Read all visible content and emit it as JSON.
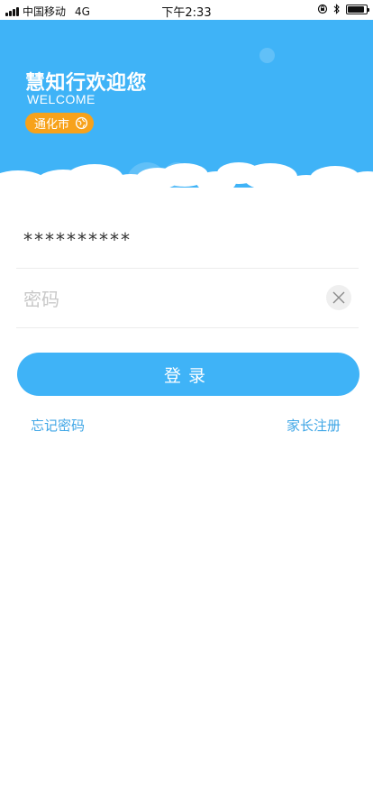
{
  "status_bar": {
    "carrier": "中国移动",
    "network": "4G",
    "time": "下午2:33",
    "battery_level": 0.9
  },
  "header": {
    "title": "慧知行欢迎您",
    "subtitle": "WELCOME",
    "city": "通化市",
    "city_icon": "location-target-icon",
    "background_color": "#3fb3f7",
    "badge_color": "#f7a21b"
  },
  "form": {
    "username_value": "**********",
    "password_placeholder": "密码",
    "clear_icon": "close-icon",
    "login_label": "登录"
  },
  "links": {
    "forgot_password": "忘记密码",
    "parent_register": "家长注册"
  }
}
